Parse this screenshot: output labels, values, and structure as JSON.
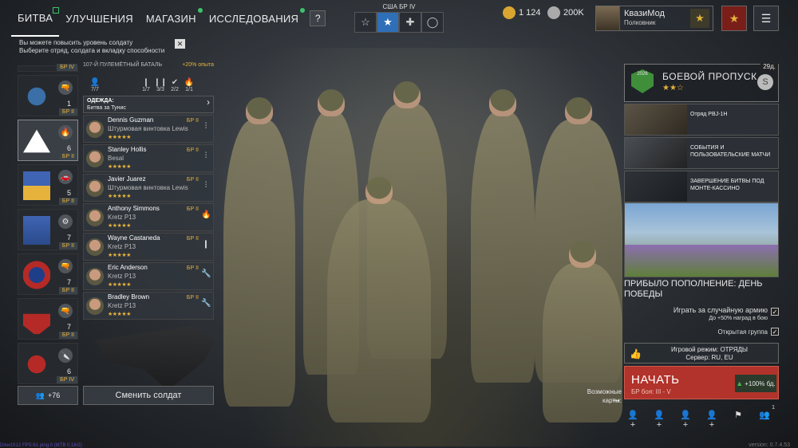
{
  "nav": {
    "tabs": [
      {
        "label": "БИТВА",
        "active": true
      },
      {
        "label": "УЛУЧШЕНИЯ"
      },
      {
        "label": "МАГАЗИН"
      },
      {
        "label": "ИССЛЕДОВАНИЯ"
      }
    ],
    "help": "?"
  },
  "br_selector": {
    "label": "США БР IV",
    "tabs": [
      "☆",
      "★",
      "✚",
      "◯"
    ]
  },
  "currency": {
    "gold": "1 124",
    "silver": "200K"
  },
  "profile": {
    "name": "КвазиМод",
    "rank": "Полковник"
  },
  "notice": {
    "line1": "Вы можете повысить уровень солдату",
    "line2": "Выберите отряд, солдата и вкладку способности",
    "close": "✕"
  },
  "squads": [
    {
      "count": "1",
      "br": "БР II",
      "icon": "🔫"
    },
    {
      "count": "6",
      "br": "БР II",
      "icon": "🔥"
    },
    {
      "count": "5",
      "br": "БР II",
      "icon": "🚗"
    },
    {
      "count": "7",
      "br": "БР II",
      "icon": "⚙"
    },
    {
      "count": "7",
      "br": "БР II",
      "icon": "🔫"
    },
    {
      "count": "7",
      "br": "БР II",
      "icon": "🔫"
    },
    {
      "count": "6",
      "br": "БР IV",
      "icon": "🔪"
    }
  ],
  "squad_top_br": "БР IV",
  "squad_detail": {
    "name": "107-Й ПУЛЕМЁТНЫЙ БАТАЛЬ",
    "xp": "+20% опыта",
    "stats": [
      {
        "icon": "👤",
        "value": "7/7"
      },
      {
        "icon": "❙",
        "value": "1/7"
      },
      {
        "icon": "❙❙",
        "value": "3/3"
      },
      {
        "icon": "✔",
        "value": "2/2"
      },
      {
        "icon": "🔥",
        "value": "1/1"
      }
    ],
    "outfit_label": "ОДЕЖДА:",
    "outfit_value": "Битва за Тунис"
  },
  "soldiers": [
    {
      "name": "Dennis Guzman",
      "weapon": "Штурмовая винтовка Lewis",
      "br": "БР II",
      "stars": "★★★★★",
      "cls": "⫶"
    },
    {
      "name": "Stanley Hollis",
      "weapon": "Besal",
      "br": "БР II",
      "stars": "★★★★★",
      "cls": "⫶"
    },
    {
      "name": "Javier Juarez",
      "weapon": "Штурмовая винтовка Lewis",
      "br": "БР II",
      "stars": "★★★★★",
      "cls": "⫶"
    },
    {
      "name": "Anthony Simmons",
      "weapon": "Kretz P13",
      "br": "БР II",
      "stars": "★★★★★",
      "cls": "🔥"
    },
    {
      "name": "Wayne Castaneda",
      "weapon": "Kretz P13",
      "br": "БР II",
      "stars": "★★★★★",
      "cls": "❙"
    },
    {
      "name": "Eric Anderson",
      "weapon": "Kretz P13",
      "br": "БР II",
      "stars": "★★★★★",
      "cls": "🔧"
    },
    {
      "name": "Bradley Brown",
      "weapon": "Kretz P13",
      "br": "БР II",
      "stars": "★★★★★",
      "cls": "🔧"
    }
  ],
  "squad_bottom": {
    "count": "+76"
  },
  "change_soldier": "Сменить солдат",
  "pass": {
    "days": "29д.",
    "title": "БОЕВОЙ ПРОПУСК",
    "stars": "★★☆",
    "emblem": "2026",
    "coin": "S"
  },
  "events": [
    {
      "text": "Отряд PBJ-1H"
    },
    {
      "text": "СОБЫТИЯ И ПОЛЬЗОВАТЕЛЬСКИЕ МАТЧИ"
    },
    {
      "text": "ЗАВЕРШЕНИЕ БИТВЫ ПОД МОНТЕ-КАССИНО"
    }
  ],
  "promo_title": "ПРИБЫЛО ПОПОЛНЕНИЕ: ДЕНЬ ПОБЕДЫ",
  "options": {
    "random_army": "Играть за случайную армию",
    "random_bonus": "До +50% наград в бою",
    "open_group": "Открытая группа"
  },
  "mode": {
    "line1": "Игровой режим: ОТРЯДЫ",
    "line2": "Сервер: RU, EU"
  },
  "start": {
    "label": "НАЧАТЬ",
    "sub": "БР боя: III - V",
    "xp": "+100% бд."
  },
  "maps_label": "Возможные карты:",
  "bottom_icons_badge": "1",
  "version": "version: 0.7.4.53",
  "debug": "DirectX12 FPS:61 ping:0 (btTB 0.16/2)"
}
